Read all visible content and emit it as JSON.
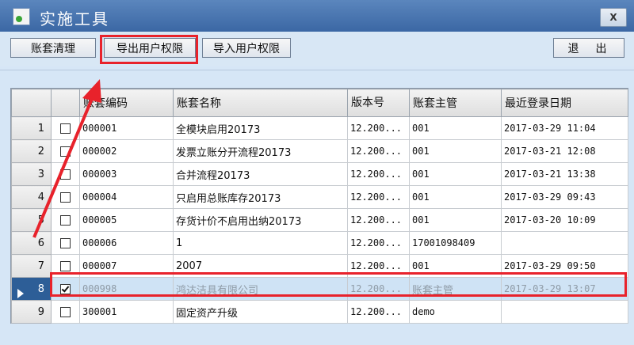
{
  "window": {
    "title": "实施工具",
    "close_label": "X"
  },
  "toolbar": {
    "clean_label": "账套清理",
    "export_label": "导出用户权限",
    "import_label": "导入用户权限",
    "exit_label": "退  出"
  },
  "grid": {
    "columns": [
      "",
      "",
      "账套编码",
      "账套名称",
      "版本号",
      "账套主管",
      "最近登录日期"
    ],
    "rows": [
      {
        "num": "1",
        "checked": false,
        "code": "000001",
        "name": "全模块启用20173",
        "version": "12.200...",
        "manager": "001",
        "date": "2017-03-29 11:04"
      },
      {
        "num": "2",
        "checked": false,
        "code": "000002",
        "name": "发票立账分开流程20173",
        "version": "12.200...",
        "manager": "001",
        "date": "2017-03-21 12:08"
      },
      {
        "num": "3",
        "checked": false,
        "code": "000003",
        "name": "合并流程20173",
        "version": "12.200...",
        "manager": "001",
        "date": "2017-03-21 13:38"
      },
      {
        "num": "4",
        "checked": false,
        "code": "000004",
        "name": "只启用总账库存20173",
        "version": "12.200...",
        "manager": "001",
        "date": "2017-03-29 09:43"
      },
      {
        "num": "5",
        "checked": false,
        "code": "000005",
        "name": "存货计价不启用出纳20173",
        "version": "12.200...",
        "manager": "001",
        "date": "2017-03-20 10:09"
      },
      {
        "num": "6",
        "checked": false,
        "code": "000006",
        "name": "1",
        "version": "12.200...",
        "manager": "17001098409",
        "date": ""
      },
      {
        "num": "7",
        "checked": false,
        "code": "000007",
        "name": "2007",
        "version": "12.200...",
        "manager": "001",
        "date": "2017-03-29 09:50"
      },
      {
        "num": "8",
        "checked": true,
        "code": "000998",
        "name": "鸿达洁具有限公司",
        "version": "12.200...",
        "manager": "账套主管",
        "date": "2017-03-29 13:07"
      },
      {
        "num": "9",
        "checked": false,
        "code": "300001",
        "name": "固定资产升级",
        "version": "12.200...",
        "manager": "demo",
        "date": ""
      }
    ]
  },
  "colors": {
    "highlight": "#e8222b",
    "titlebar": "#3b67a4",
    "selected_row": "#cfe3f5"
  }
}
